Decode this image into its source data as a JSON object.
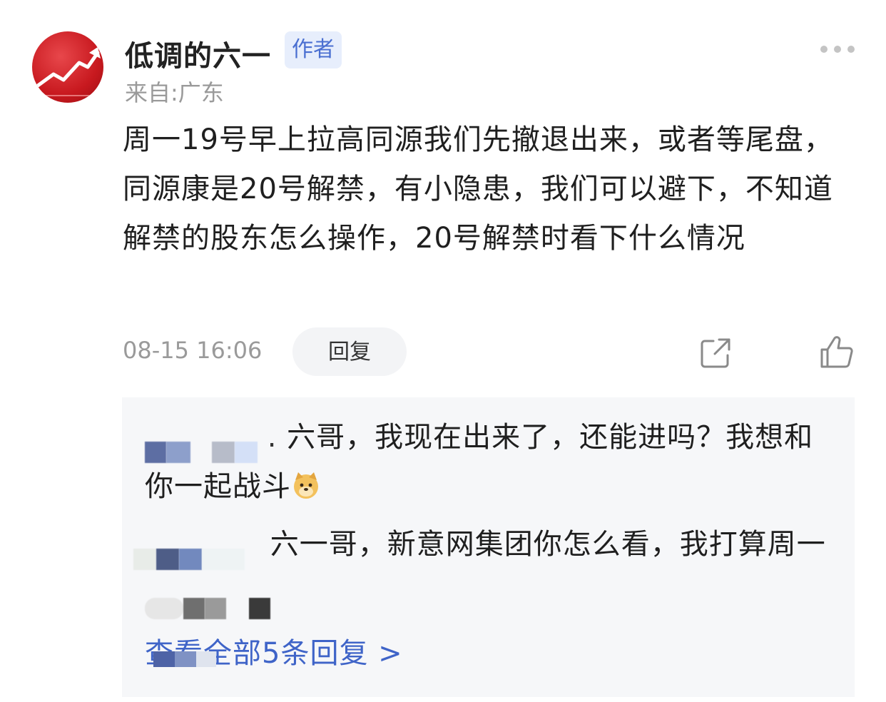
{
  "author": {
    "name": "低调的六一",
    "badge": "作者",
    "location": "来自:广东"
  },
  "post": {
    "content": "周一19号早上拉高同源我们先撤退出来，或者等尾盘，同源康是20号解禁，有小隐患，我们可以避下，不知道解禁的股东怎么操作，20号解禁时看下什么情况",
    "time": "08-15 16:06",
    "reply_label": "回复"
  },
  "replies": [
    {
      "text": "六哥，我现在出来了，还能进吗？我想和你一起战斗",
      "emoji": "dog-face-icon"
    },
    {
      "text": "六一哥，新意网集团你怎么看，我打算周一"
    }
  ],
  "view_all_label": "查看全部5条回复 >",
  "colors": {
    "accent_blue": "#3f64c8",
    "badge_bg": "#e7eefc",
    "badge_text": "#4a6fd1",
    "panel_bg": "#f6f7f9",
    "muted_text": "#9a9a9a"
  }
}
